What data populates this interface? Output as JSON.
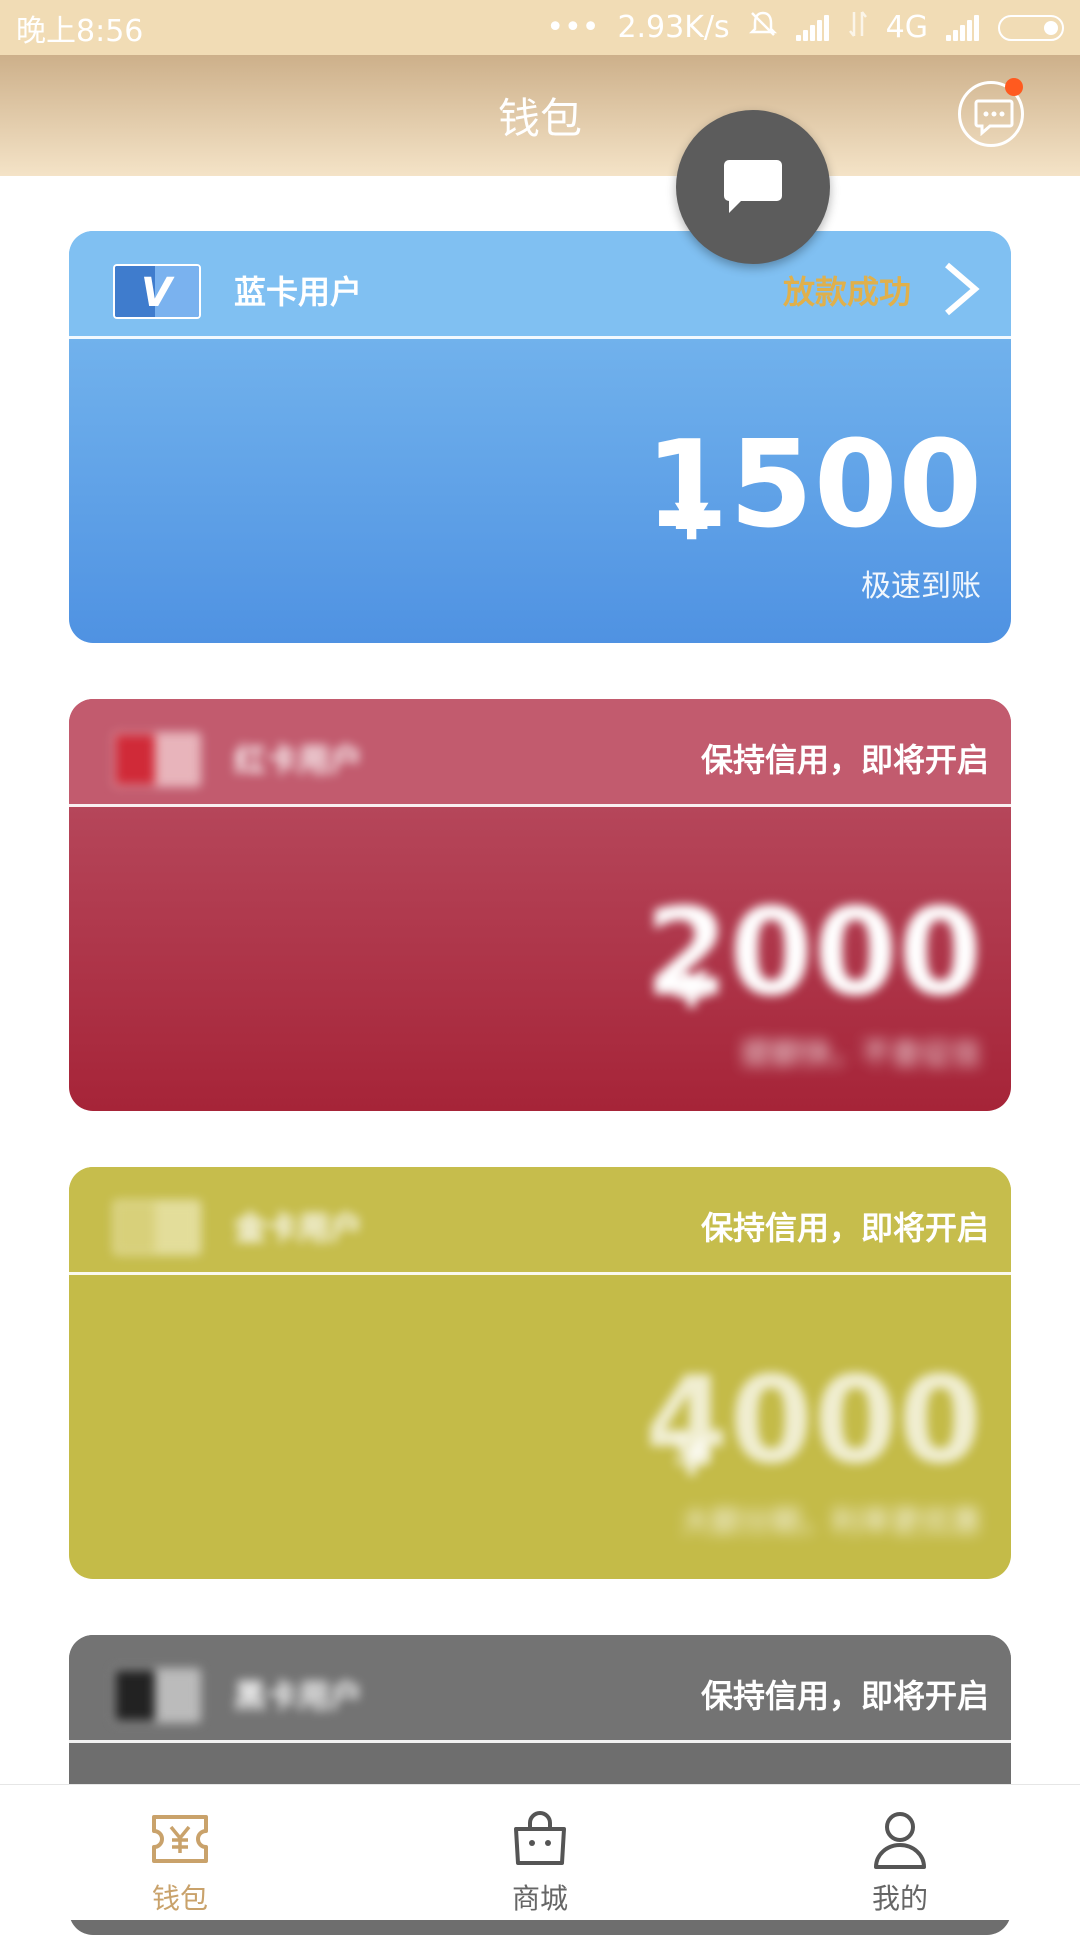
{
  "status_bar": {
    "time": "晚上8:56",
    "dots": "•••",
    "speed": "2.93K/s",
    "network": "4G"
  },
  "header": {
    "title": "钱包",
    "icons": {
      "message": "chat-bubble-icon",
      "floating": "chat-bubble-icon"
    },
    "colors": {
      "notification_dot": "#ff5a1f",
      "header_gold": "#cdb08a"
    }
  },
  "cards": [
    {
      "name": "蓝卡用户",
      "status": "放款成功",
      "currency": "¥",
      "amount": "1500",
      "sub": "极速到账",
      "color": "#4f92e2",
      "status_color": "#e0b04b"
    },
    {
      "name": "红卡用户",
      "status": "保持信用，即将开启",
      "currency": "¥",
      "amount": "2000",
      "sub": "提额快，不查征信",
      "color": "#a62438"
    },
    {
      "name": "金卡用户",
      "status": "保持信用，即将开启",
      "currency": "¥",
      "amount": "4000",
      "sub": "大额分期，利率更优惠",
      "color": "#c4bb48"
    },
    {
      "name": "黑卡用户",
      "status": "保持信用，即将开启",
      "color": "#6e6e6e"
    }
  ],
  "tabbar": {
    "items": [
      {
        "label": "钱包",
        "icon": "wallet-yen-icon",
        "active": true
      },
      {
        "label": "商城",
        "icon": "shopping-bag-icon",
        "active": false
      },
      {
        "label": "我的",
        "icon": "user-icon",
        "active": false
      }
    ],
    "active_color": "#c9a26b"
  }
}
